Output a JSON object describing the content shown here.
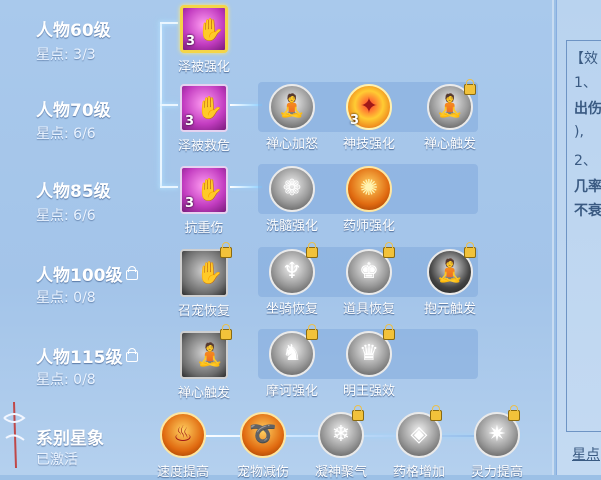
{
  "rows": [
    {
      "level": "人物60级",
      "stars": "星点: 3/3",
      "locked": false
    },
    {
      "level": "人物70级",
      "stars": "星点: 6/6",
      "locked": false
    },
    {
      "level": "人物85级",
      "stars": "星点: 6/6",
      "locked": false
    },
    {
      "level": "人物100级",
      "stars": "星点: 0/8",
      "locked": true
    },
    {
      "level": "人物115级",
      "stars": "星点: 0/8",
      "locked": true
    }
  ],
  "constellation": {
    "title": "系别星象",
    "status": "已激活"
  },
  "skills": {
    "r1": [
      {
        "label": "泽被强化",
        "count": "3"
      }
    ],
    "r2": [
      {
        "label": "泽被救危",
        "count": "3"
      },
      {
        "label": "禅心加怒"
      },
      {
        "label": "神技强化",
        "count": "3"
      },
      {
        "label": "禅心触发"
      }
    ],
    "r3": [
      {
        "label": "抗重伤",
        "count": "3"
      },
      {
        "label": "洗髓强化"
      },
      {
        "label": "药师强化"
      }
    ],
    "r4": [
      {
        "label": "召宠恢复"
      },
      {
        "label": "坐骑恢复"
      },
      {
        "label": "道具恢复"
      },
      {
        "label": "抱元触发"
      }
    ],
    "r5": [
      {
        "label": "禅心触发"
      },
      {
        "label": "摩诃强化"
      },
      {
        "label": "明王强效"
      }
    ],
    "r6": [
      {
        "label": "速度提高"
      },
      {
        "label": "宠物减伤"
      },
      {
        "label": "凝神聚气"
      },
      {
        "label": "药格增加"
      },
      {
        "label": "灵力提高"
      }
    ]
  },
  "right_panel": {
    "t1": "【效",
    "t2": "1、",
    "t3": "出伤",
    "t4": "),",
    "t5": "2、",
    "t6": "几率",
    "t7": "不衰",
    "t8": "星点"
  }
}
